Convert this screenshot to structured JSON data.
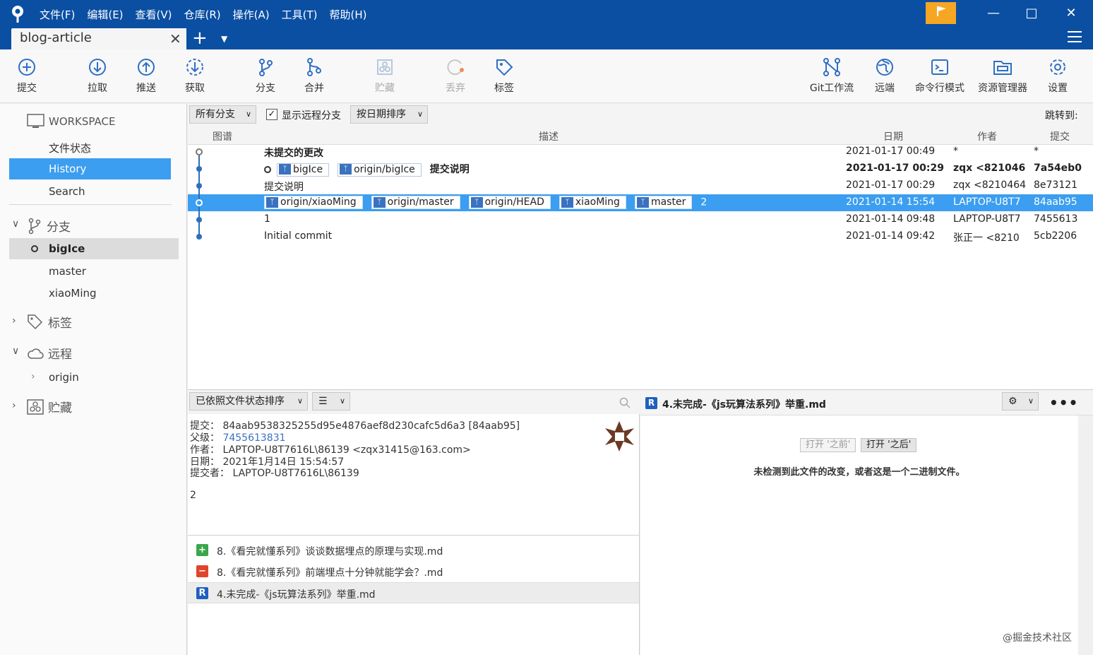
{
  "app": {
    "menu": [
      "文件(F)",
      "编辑(E)",
      "查看(V)",
      "仓库(R)",
      "操作(A)",
      "工具(T)",
      "帮助(H)"
    ],
    "tab_title": "blog-article",
    "accent": "#0b4fa3",
    "flag_color": "#f5a623",
    "selection_color": "#3b9ef0"
  },
  "toolbar": {
    "commit": "提交",
    "pull": "拉取",
    "push": "推送",
    "fetch": "获取",
    "branch": "分支",
    "merge": "合并",
    "stash": "贮藏",
    "discard": "丢弃",
    "tag": "标签",
    "gitflow": "Git工作流",
    "remote": "远端",
    "terminal": "命令行模式",
    "explorer": "资源管理器",
    "settings": "设置"
  },
  "sidebar": {
    "workspace": "WORKSPACE",
    "file_status": "文件状态",
    "history": "History",
    "search": "Search",
    "branches_title": "分支",
    "branches": [
      "bigIce",
      "master",
      "xiaoMing"
    ],
    "tags_title": "标签",
    "remotes_title": "远程",
    "remotes": [
      "origin"
    ],
    "stash_title": "贮藏"
  },
  "filter": {
    "branches": "所有分支",
    "show_remote": "显示远程分支",
    "sort": "按日期排序",
    "jump": "跳转到:"
  },
  "columns": {
    "graph": "图谱",
    "desc": "描述",
    "date": "日期",
    "author": "作者",
    "commit": "提交"
  },
  "commits": [
    {
      "desc": "未提交的更改",
      "date": "2021-01-17 00:49",
      "author": "*",
      "hash": "*"
    },
    {
      "refs": [
        "bigIce",
        "origin/bigIce"
      ],
      "desc": "提交说明",
      "date": "2021-01-17 00:29",
      "author": "zqx <821046",
      "hash": "7a54eb0"
    },
    {
      "desc": "提交说明",
      "date": "2021-01-17 00:29",
      "author": "zqx <8210464",
      "hash": "8e73121"
    },
    {
      "refs": [
        "origin/xiaoMing",
        "origin/master",
        "origin/HEAD",
        "xiaoMing",
        "master"
      ],
      "desc": "2",
      "date": "2021-01-14 15:54",
      "author": "LAPTOP-U8T7",
      "hash": "84aab95"
    },
    {
      "desc": "1",
      "date": "2021-01-14 09:48",
      "author": "LAPTOP-U8T7",
      "hash": "7455613"
    },
    {
      "desc": "Initial commit",
      "date": "2021-01-14 09:42",
      "author": "张正一 <8210",
      "hash": "5cb2206"
    }
  ],
  "details": {
    "sort_label": "已依照文件状态排序",
    "commit_label": "提交：",
    "commit_value": "84aab9538325255d95e4876aef8d230cafc5d6a3 [84aab95]",
    "parent_label": "父级：",
    "parent_value": "7455613831",
    "author_label": "作者：",
    "author_value": "LAPTOP-U8T7616L\\86139 <zqx31415@163.com>",
    "date_label": "日期：",
    "date_value": "2021年1月14日 15:54:57",
    "committer_label": "提交者：",
    "committer_value": "LAPTOP-U8T7616L\\86139",
    "message": "2"
  },
  "files": [
    {
      "status": "added",
      "icon": "+",
      "color": "#3aa64a",
      "name": "8.《看完就懂系列》谈谈数据埋点的原理与实现.md"
    },
    {
      "status": "removed",
      "icon": "−",
      "color": "#e0442a",
      "name": "8.《看完就懂系列》前端埋点十分钟就能学会？.md"
    },
    {
      "status": "renamed",
      "icon": "R",
      "color": "#1f5fbf",
      "name": "4.未完成-《js玩算法系列》举重.md"
    }
  ],
  "diff": {
    "file": "4.未完成-《js玩算法系列》举重.md",
    "open_before": "打开 '之前'",
    "open_after": "打开 '之后'",
    "message": "未检测到此文件的改变，或者这是一个二进制文件。"
  },
  "watermark": "@掘金技术社区"
}
